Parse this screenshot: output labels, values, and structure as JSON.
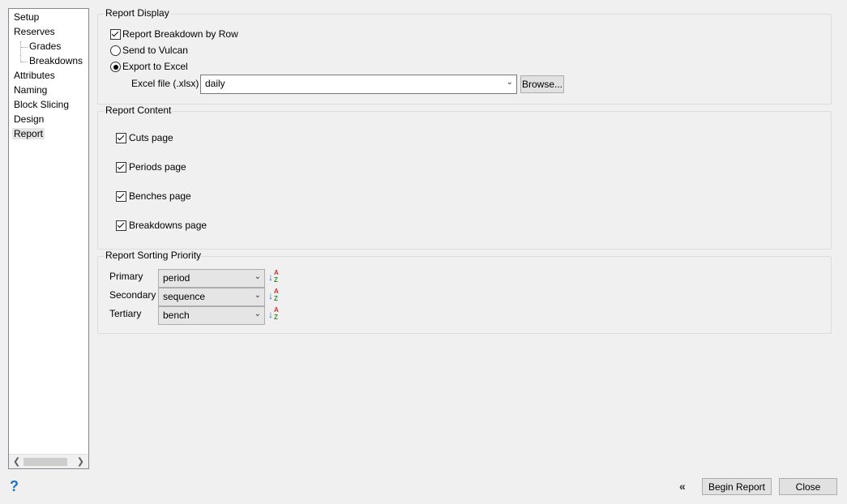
{
  "tree": {
    "items": [
      {
        "label": "Setup"
      },
      {
        "label": "Reserves"
      },
      {
        "label": "Grades"
      },
      {
        "label": "Breakdowns"
      },
      {
        "label": "Attributes"
      },
      {
        "label": "Naming"
      },
      {
        "label": "Block Slicing"
      },
      {
        "label": "Design"
      },
      {
        "label": "Report"
      }
    ],
    "selected": "Report"
  },
  "report_display": {
    "title": "Report Display",
    "breakdown_by_row": {
      "label": "Report Breakdown by Row",
      "checked": true
    },
    "send_to_vulcan": {
      "label": "Send to Vulcan",
      "selected": false
    },
    "export_to_excel": {
      "label": "Export to Excel",
      "selected": true
    },
    "excel_file_label": "Excel file (.xlsx)",
    "excel_file_value": "daily",
    "browse_label": "Browse..."
  },
  "report_content": {
    "title": "Report Content",
    "items": [
      {
        "label": "Cuts page",
        "checked": true
      },
      {
        "label": "Periods page",
        "checked": true
      },
      {
        "label": "Benches page",
        "checked": true
      },
      {
        "label": "Breakdowns page",
        "checked": true
      }
    ]
  },
  "report_sorting": {
    "title": "Report Sorting Priority",
    "rows": [
      {
        "label": "Primary",
        "value": "period"
      },
      {
        "label": "Secondary",
        "value": "sequence"
      },
      {
        "label": "Tertiary",
        "value": "bench"
      }
    ]
  },
  "footer": {
    "begin_label": "Begin Report",
    "close_label": "Close"
  },
  "icons": {
    "help": "help-icon",
    "collapse": "double-chevron-left-icon",
    "sort": "sort-ascending-icon"
  }
}
